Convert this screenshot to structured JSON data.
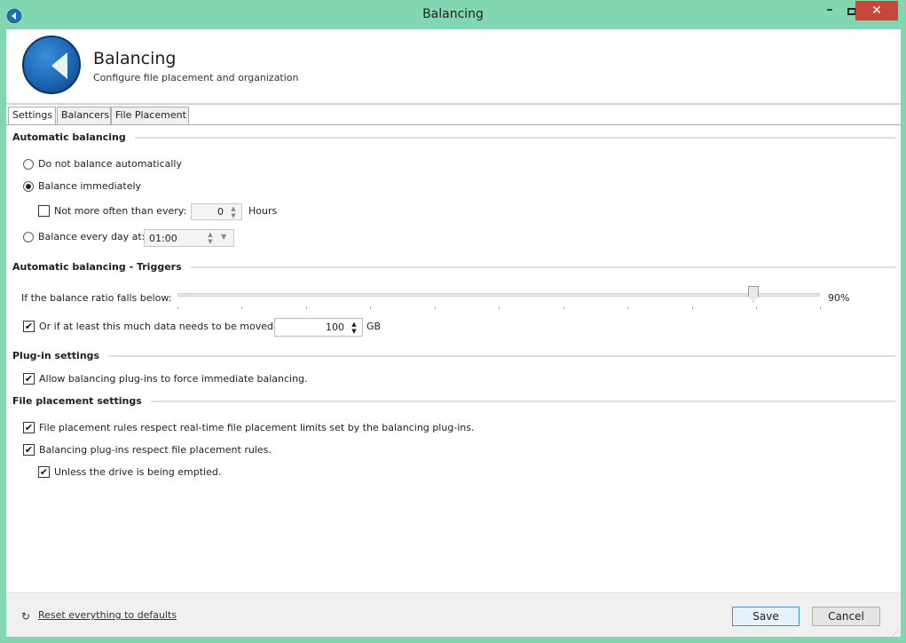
{
  "window": {
    "title": "Balancing",
    "min_glyph": "–",
    "close_glyph": "✕"
  },
  "header": {
    "title": "Balancing",
    "subtitle": "Configure file placement and organization"
  },
  "tabs": [
    {
      "label": "Settings",
      "active": true
    },
    {
      "label": "Balancers",
      "active": false
    },
    {
      "label": "File Placement",
      "active": false
    }
  ],
  "automatic_balancing": {
    "title": "Automatic balancing",
    "option_none": "Do not balance automatically",
    "option_immediate": "Balance immediately",
    "not_more_often_label": "Not more often than every:",
    "not_more_often_value": "0",
    "not_more_often_unit": "Hours",
    "option_daily": "Balance every day at:",
    "daily_time": "01:00",
    "selected": "immediate"
  },
  "triggers": {
    "title": "Automatic balancing - Triggers",
    "ratio_label": "If the balance ratio falls below:",
    "ratio_value": "90%",
    "ratio_fraction": 0.9,
    "data_moved_label": "Or if at least this much data needs to be moved:",
    "data_moved_value": "100",
    "data_moved_unit": "GB",
    "data_moved_checked": true
  },
  "plugin_settings": {
    "title": "Plug-in settings",
    "allow_force": "Allow balancing plug-ins to force immediate balancing.",
    "allow_force_checked": true
  },
  "file_placement": {
    "title": "File placement settings",
    "respect_limits": "File placement rules respect real-time file placement limits set by the balancing plug-ins.",
    "plugins_respect_rules": "Balancing plug-ins respect file placement rules.",
    "unless_emptied": "Unless the drive is being emptied."
  },
  "footer": {
    "reset_link": "Reset everything to defaults",
    "save": "Save",
    "cancel": "Cancel"
  },
  "colors": {
    "frame": "#83d6b2",
    "close_button": "#c8473b",
    "accent_blue": "#1d66b3"
  }
}
